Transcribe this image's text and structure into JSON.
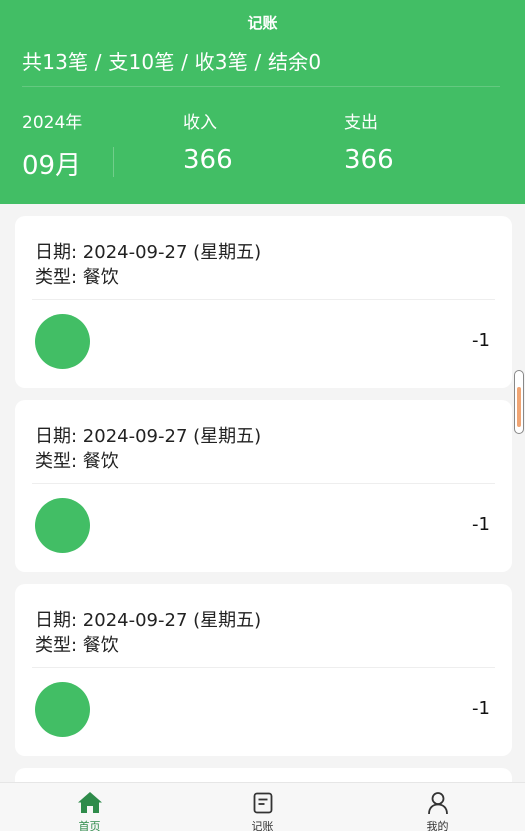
{
  "header": {
    "title": "记账",
    "summary": "共13笔 / 支10笔 / 收3笔 / 结余0",
    "year": "2024年",
    "month": "09月",
    "income_label": "收入",
    "income_value": "366",
    "expense_label": "支出",
    "expense_value": "366"
  },
  "records": [
    {
      "date": "日期: 2024-09-27 (星期五)",
      "type": "类型: 餐饮",
      "amount": "-1"
    },
    {
      "date": "日期: 2024-09-27 (星期五)",
      "type": "类型: 餐饮",
      "amount": "-1"
    },
    {
      "date": "日期: 2024-09-27 (星期五)",
      "type": "类型: 餐饮",
      "amount": "-1"
    }
  ],
  "tabbar": {
    "items": [
      {
        "label": "首页",
        "icon": "home-icon",
        "active": true
      },
      {
        "label": "记账",
        "icon": "document-icon",
        "active": false
      },
      {
        "label": "我的",
        "icon": "user-icon",
        "active": false
      }
    ]
  },
  "colors": {
    "accent": "#42be65",
    "active_tab": "#2e8b4a",
    "background": "#f4f4f4",
    "scroll_thumb": "#f0a574"
  }
}
